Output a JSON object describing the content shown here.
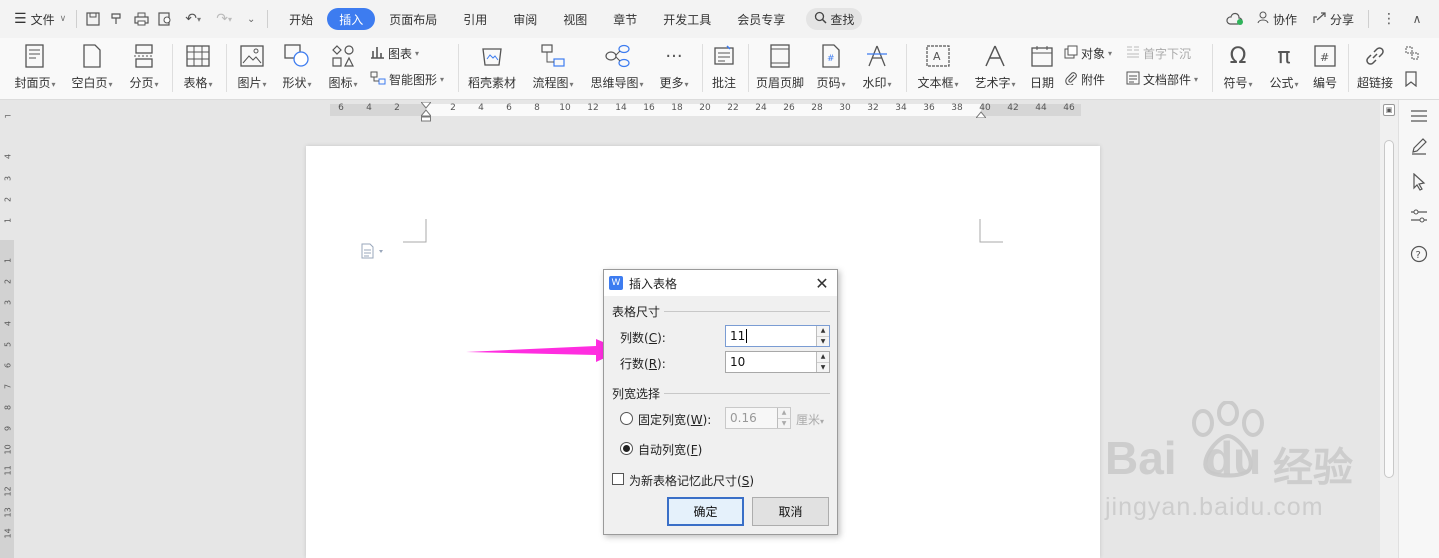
{
  "menubar": {
    "file_label": "文件",
    "tabs": [
      {
        "label": "开始",
        "active": false
      },
      {
        "label": "插入",
        "active": true
      },
      {
        "label": "页面布局",
        "active": false
      },
      {
        "label": "引用",
        "active": false
      },
      {
        "label": "审阅",
        "active": false
      },
      {
        "label": "视图",
        "active": false
      },
      {
        "label": "章节",
        "active": false
      },
      {
        "label": "开发工具",
        "active": false
      },
      {
        "label": "会员专享",
        "active": false
      }
    ],
    "search_label": "查找",
    "collab_label": "协作",
    "share_label": "分享"
  },
  "ribbon": {
    "cover": "封面页",
    "blank": "空白页",
    "pagebreak": "分页",
    "table": "表格",
    "picture": "图片",
    "shape": "形状",
    "icon": "图标",
    "chart": "图表",
    "smartart": "智能图形",
    "material": "稻壳素材",
    "flowchart": "流程图",
    "mindmap": "思维导图",
    "more": "更多",
    "comment": "批注",
    "header_footer": "页眉页脚",
    "page_number": "页码",
    "watermark": "水印",
    "textbox": "文本框",
    "wordart": "艺术字",
    "date": "日期",
    "object": "对象",
    "attachment": "附件",
    "dropcap": "首字下沉",
    "docpart": "文档部件",
    "symbol": "符号",
    "formula": "公式",
    "numbering": "编号",
    "hyperlink": "超链接"
  },
  "ruler": {
    "h_numbers": [
      "6",
      "4",
      "2",
      "2",
      "4",
      "6",
      "8",
      "10",
      "12",
      "14",
      "16",
      "18",
      "20",
      "22",
      "24",
      "26",
      "28",
      "30",
      "32",
      "34",
      "36",
      "38",
      "40",
      "42",
      "44",
      "46"
    ],
    "v_numbers": [
      "4",
      "3",
      "2",
      "1",
      "1",
      "2",
      "3",
      "4",
      "5",
      "6",
      "7",
      "8",
      "9",
      "10",
      "11",
      "12",
      "13",
      "14"
    ]
  },
  "dialog": {
    "title": "插入表格",
    "group_size": "表格尺寸",
    "cols_label": "列数(",
    "cols_key": "C",
    "cols_tail": "):",
    "cols_value": "11",
    "rows_label": "行数(",
    "rows_key": "R",
    "rows_tail": "):",
    "rows_value": "10",
    "group_width": "列宽选择",
    "fixed_label": "固定列宽(",
    "fixed_key": "W",
    "fixed_tail": "):",
    "fixed_value": "0.16",
    "fixed_unit": "厘米",
    "auto_label": "自动列宽(",
    "auto_key": "F",
    "auto_tail": ")",
    "auto_selected": true,
    "remember_label": "为新表格记忆此尺寸(",
    "remember_key": "S",
    "remember_tail": ")",
    "remember_checked": false,
    "ok": "确定",
    "cancel": "取消"
  },
  "watermark": {
    "brand": "Bai",
    "brand_tail": "du",
    "cn": "经验",
    "url": "jingyan.baidu.com"
  },
  "colors": {
    "accent": "#3d7cf0",
    "arrow": "#ff2de0"
  }
}
